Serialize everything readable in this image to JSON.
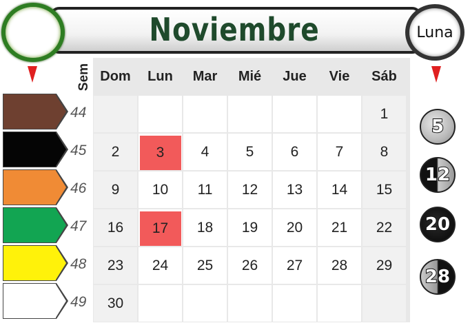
{
  "header": {
    "title": "Noviembre",
    "moon_label": "Luna"
  },
  "calendar": {
    "week_label": "Sem",
    "day_headers": [
      "Dom",
      "Lun",
      "Mar",
      "Mié",
      "Jue",
      "Vie",
      "Sáb"
    ],
    "weeks": [
      {
        "number": "44",
        "color": "#6e4030",
        "days": [
          "",
          "",
          "",
          "",
          "",
          "",
          "1"
        ]
      },
      {
        "number": "45",
        "color": "#050505",
        "days": [
          "2",
          "3",
          "4",
          "5",
          "6",
          "7",
          "8"
        ]
      },
      {
        "number": "46",
        "color": "#f08b35",
        "days": [
          "9",
          "10",
          "11",
          "12",
          "13",
          "14",
          "15"
        ]
      },
      {
        "number": "47",
        "color": "#12a552",
        "days": [
          "16",
          "17",
          "18",
          "19",
          "20",
          "21",
          "22"
        ]
      },
      {
        "number": "48",
        "color": "#fff20a",
        "days": [
          "23",
          "24",
          "25",
          "26",
          "27",
          "28",
          "29"
        ]
      },
      {
        "number": "49",
        "color": "#ffffff",
        "days": [
          "30",
          "",
          "",
          "",
          "",
          "",
          ""
        ]
      }
    ],
    "highlighted_days": [
      "3",
      "17"
    ],
    "highlight_color": "#f25a5a"
  },
  "moon_phases": [
    {
      "day": "5",
      "icon": "full-moon-icon"
    },
    {
      "day": "12",
      "icon": "waning-moon-icon"
    },
    {
      "day": "20",
      "icon": "new-moon-icon"
    },
    {
      "day": "28",
      "icon": "waxing-moon-icon"
    }
  ]
}
